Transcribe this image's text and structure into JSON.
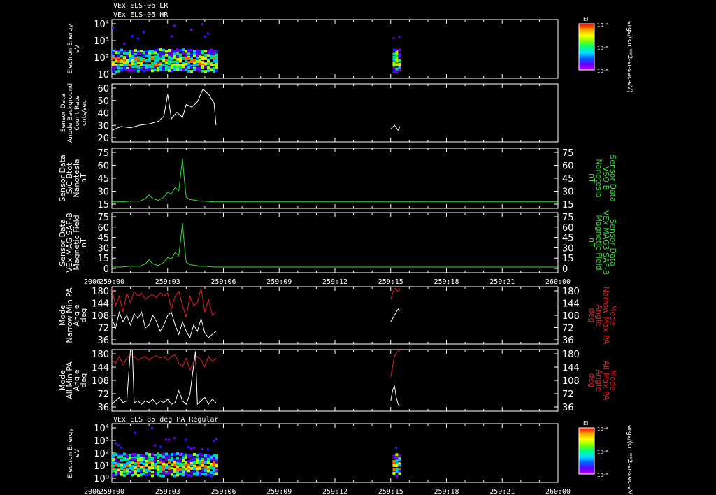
{
  "colors": {
    "bg": "#000000",
    "axis": "#ffffff",
    "white_series": "#ffffff",
    "green_series": "#33dd33",
    "red_series": "#e02020"
  },
  "header": {
    "title_lr": "VEx ELS-06 LR",
    "title_hr": "VEx ELS-06 HR",
    "title_pa": "VEx ELS 85 deg PA Regular"
  },
  "colorbar": {
    "label": "EI",
    "ticks": [
      "10⁻⁴",
      "10⁻⁶",
      "10⁻⁸"
    ],
    "unit": "ergs/(cm**2-sr-sec-eV)"
  },
  "x_axis": {
    "year": "2006",
    "ticks": [
      "259:00",
      "259:03",
      "259:06",
      "259:09",
      "259:12",
      "259:15",
      "259:18",
      "259:21",
      "260:00"
    ]
  },
  "chart_data": [
    {
      "type": "heatmap",
      "name": "Electron Energy LR/HR",
      "ylabel": [
        "Electron Energy",
        "eV"
      ],
      "y_ticks": [
        "10⁴",
        "10³",
        "10²",
        "10"
      ],
      "y_scale": "log",
      "x_segments": [
        [
          0.0,
          5.6
        ],
        [
          15.1,
          15.55
        ]
      ],
      "ylim": [
        1,
        10000
      ]
    },
    {
      "type": "line",
      "name": "Anode Background",
      "ylabel": [
        "Sensor Data",
        "Anode Background",
        "Count Rate",
        "cnts/sec"
      ],
      "y_ticks": [
        "60",
        "50",
        "40",
        "30",
        "20"
      ],
      "ylim": [
        15,
        60
      ],
      "color": "#ffffff",
      "segments": [
        {
          "x": [
            0.0,
            0.5,
            1.0,
            1.5,
            2.0,
            2.5,
            2.8,
            3.0,
            3.2,
            3.5,
            3.8,
            4.0,
            4.3,
            4.6,
            4.9,
            5.2,
            5.5,
            5.6
          ],
          "y": [
            24,
            27,
            26,
            28,
            29,
            31,
            35,
            52,
            33,
            38,
            34,
            44,
            42,
            46,
            56,
            52,
            45,
            28
          ]
        },
        {
          "x": [
            15.0,
            15.2,
            15.4,
            15.5
          ],
          "y": [
            25,
            28,
            24,
            27
          ]
        }
      ]
    },
    {
      "type": "line",
      "name": "S/C Btot",
      "ylabel": [
        "Sensor Data",
        "S/C Btot",
        "Nanotesla",
        "nT"
      ],
      "ylabel_right": [
        "Sensor Data",
        "VSO B",
        "Nanotesla",
        "nT"
      ],
      "y_ticks": [
        "75",
        "60",
        "45",
        "30",
        "15"
      ],
      "ylim": [
        0,
        75
      ],
      "color": "#33dd33",
      "x": [
        0.0,
        0.5,
        1.0,
        1.5,
        1.8,
        2.0,
        2.2,
        2.5,
        2.8,
        3.0,
        3.2,
        3.4,
        3.6,
        3.8,
        3.9,
        4.0,
        4.2,
        4.5,
        4.8,
        5.0,
        5.5,
        6.0,
        9.0,
        12.0,
        15.0,
        18.0,
        21.0,
        24.0
      ],
      "y": [
        8,
        8,
        9,
        9,
        12,
        17,
        12,
        10,
        14,
        20,
        18,
        26,
        22,
        62,
        35,
        14,
        11,
        10,
        9,
        9,
        8,
        8,
        8,
        8,
        8,
        8,
        8,
        8
      ]
    },
    {
      "type": "line",
      "name": "VEx MAG SAF-B Magnetic Field",
      "ylabel": [
        "Sensor Data",
        "VEx MAG SAF-B",
        "Magnetic Field",
        "nT"
      ],
      "ylabel_right": [
        "Sensor Data",
        "VEx MAG3 SAF-B",
        "Magnetic Field",
        "nT"
      ],
      "y_ticks": [
        "75",
        "60",
        "45",
        "30",
        "15",
        "0"
      ],
      "ylim": [
        0,
        75
      ],
      "color": "#33dd33",
      "x": [
        0.0,
        0.5,
        1.0,
        1.5,
        1.8,
        2.0,
        2.2,
        2.5,
        2.8,
        3.0,
        3.2,
        3.4,
        3.6,
        3.8,
        3.9,
        4.0,
        4.2,
        4.5,
        4.8,
        5.0,
        5.5,
        6.0,
        9.0,
        12.0,
        15.0,
        18.0,
        21.0,
        24.0
      ],
      "y": [
        7,
        7,
        8,
        8,
        11,
        16,
        11,
        9,
        13,
        19,
        17,
        25,
        21,
        62,
        34,
        13,
        10,
        9,
        8,
        8,
        7,
        7,
        7,
        7,
        7,
        7,
        7,
        7
      ]
    },
    {
      "type": "line",
      "name": "Mode Narrow PA",
      "ylabel": [
        "Mode",
        "Narrow Min PA",
        "Angle",
        "deg"
      ],
      "ylabel_right": [
        "Mode",
        "Narrow Max PA",
        "Angle",
        "deg"
      ],
      "y_ticks": [
        "180",
        "144",
        "108",
        "72",
        "36"
      ],
      "ylim": [
        0,
        180
      ],
      "series": [
        {
          "color": "#e02020",
          "segments": [
            {
              "x": [
                0.0,
                0.2,
                0.4,
                0.6,
                0.8,
                1.0,
                1.2,
                1.4,
                1.6,
                1.8,
                2.0,
                2.2,
                2.4,
                2.6,
                2.8,
                3.0,
                3.2,
                3.4,
                3.6,
                3.8,
                4.0,
                4.2,
                4.4,
                4.6,
                4.8,
                5.0,
                5.2,
                5.4,
                5.6
              ],
              "y": [
                175,
                120,
                150,
                100,
                160,
                130,
                165,
                150,
                160,
                140,
                150,
                155,
                145,
                160,
                150,
                160,
                110,
                150,
                165,
                120,
                85,
                150,
                120,
                130,
                175,
                100,
                140,
                90,
                100
              ]
            },
            {
              "x": [
                15.0,
                15.2,
                15.4,
                15.5
              ],
              "y": [
                140,
                175,
                165,
                175
              ]
            }
          ]
        },
        {
          "color": "#ffffff",
          "segments": [
            {
              "x": [
                0.0,
                0.2,
                0.4,
                0.6,
                0.8,
                1.0,
                1.2,
                1.4,
                1.6,
                1.8,
                2.0,
                2.2,
                2.4,
                2.6,
                2.8,
                3.0,
                3.2,
                3.4,
                3.6,
                3.8,
                4.0,
                4.2,
                4.4,
                4.6,
                4.8,
                5.0,
                5.2,
                5.4,
                5.6
              ],
              "y": [
                80,
                50,
                100,
                70,
                90,
                60,
                95,
                80,
                100,
                50,
                60,
                90,
                70,
                40,
                60,
                90,
                100,
                60,
                30,
                70,
                40,
                20,
                60,
                40,
                80,
                35,
                20,
                30,
                40
              ]
            },
            {
              "x": [
                15.0,
                15.1,
                15.2,
                15.3,
                15.4,
                15.5
              ],
              "y": [
                70,
                80,
                90,
                100,
                110,
                105
              ]
            }
          ]
        }
      ]
    },
    {
      "type": "line",
      "name": "Mode All PA",
      "ylabel": [
        "Mode",
        "All Min PA",
        "Angle",
        "deg"
      ],
      "ylabel_right": [
        "Mode",
        "All Max PA",
        "Angle",
        "deg"
      ],
      "y_ticks": [
        "180",
        "144",
        "108",
        "72",
        "36"
      ],
      "ylim": [
        0,
        180
      ],
      "series": [
        {
          "color": "#e02020",
          "segments": [
            {
              "x": [
                0.0,
                0.2,
                0.4,
                0.6,
                0.8,
                1.0,
                1.2,
                1.4,
                1.6,
                1.8,
                2.0,
                2.2,
                2.4,
                2.6,
                2.8,
                3.0,
                3.2,
                3.4,
                3.6,
                3.8,
                4.0,
                4.2,
                4.4,
                4.6,
                4.8,
                5.0,
                5.2,
                5.4,
                5.6
              ],
              "y": [
                150,
                140,
                160,
                135,
                155,
                165,
                160,
                150,
                155,
                160,
                150,
                158,
                162,
                155,
                160,
                150,
                160,
                165,
                140,
                130,
                155,
                120,
                145,
                160,
                150,
                130,
                160,
                145,
                155
              ]
            },
            {
              "x": [
                15.0,
                15.1,
                15.2,
                15.3,
                15.4,
                15.5
              ],
              "y": [
                100,
                130,
                160,
                170,
                175,
                178
              ]
            }
          ]
        },
        {
          "color": "#ffffff",
          "segments": [
            {
              "x": [
                0.0,
                0.2,
                0.4,
                0.6,
                0.8,
                1.0,
                1.1,
                1.2,
                1.4,
                1.6,
                1.8,
                2.0,
                2.2,
                2.4,
                2.6,
                2.8,
                3.0,
                3.2,
                3.4,
                3.6,
                3.8,
                4.0,
                4.2,
                4.5,
                4.6,
                4.8,
                5.0,
                5.2,
                5.4,
                5.6
              ],
              "y": [
                20,
                30,
                40,
                25,
                30,
                180,
                180,
                25,
                30,
                20,
                30,
                25,
                35,
                20,
                30,
                25,
                35,
                20,
                25,
                60,
                30,
                20,
                50,
                175,
                20,
                30,
                40,
                20,
                35,
                25
              ]
            },
            {
              "x": [
                15.0,
                15.1,
                15.2,
                15.3,
                15.4,
                15.5
              ],
              "y": [
                30,
                60,
                75,
                40,
                20,
                15
              ]
            }
          ]
        }
      ]
    },
    {
      "type": "heatmap",
      "name": "Electron Energy 85 deg PA",
      "ylabel": [
        "Electron Energy",
        "eV"
      ],
      "y_ticks": [
        "10⁴",
        "10³",
        "10²",
        "10¹",
        "10⁰"
      ],
      "y_scale": "log",
      "x_segments": [
        [
          0.0,
          5.6
        ],
        [
          15.1,
          15.55
        ]
      ],
      "ylim": [
        0.5,
        10000
      ]
    }
  ]
}
